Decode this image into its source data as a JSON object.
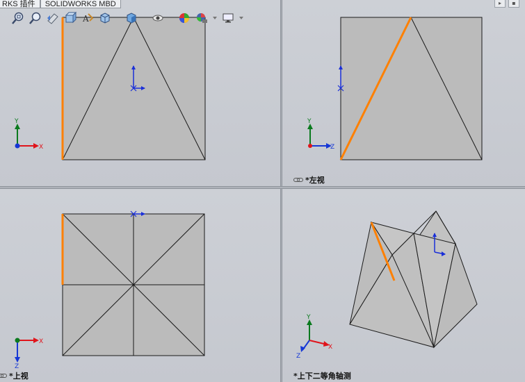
{
  "tabs": [
    {
      "label": "RKS 插件"
    },
    {
      "label": "SOLIDWORKS MBD"
    }
  ],
  "toolbar": {
    "icons": [
      "zoom-to-fit-icon",
      "zoom-to-area-icon",
      "previous-view-icon",
      "section-view-icon",
      "dynamic-annotation-views-icon",
      "view-orientation-icon",
      "display-style-icon",
      "hide-show-items-icon",
      "edit-appearance-icon",
      "apply-scene-icon",
      "view-settings-icon"
    ]
  },
  "viewports": {
    "front": {
      "label": ""
    },
    "left": {
      "label": "*左视"
    },
    "top": {
      "label": "*上视"
    },
    "iso": {
      "label": "*上下二等角轴测"
    }
  },
  "triad": {
    "x": "X",
    "y": "Y",
    "z": "Z"
  },
  "colors": {
    "face_fill": "#bbbbbb",
    "edge": "#1a1a1a",
    "highlight_edge": "#ff8000",
    "axis_x": "#e0141b",
    "axis_y": "#0a7a1e",
    "axis_z": "#1537d6",
    "origin": "#1a2fd8"
  },
  "corner_buttons": [
    "restore-icon",
    "maximize-icon"
  ]
}
